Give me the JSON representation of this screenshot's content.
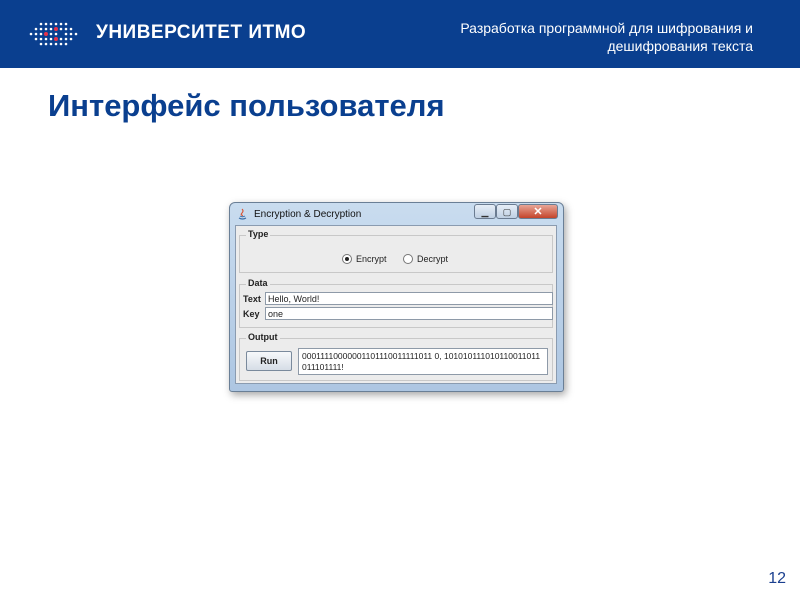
{
  "slide": {
    "brand": "УНИВЕРСИТЕТ ИТМО",
    "header_caption": "Разработка программной для шифрования и дешифрования текста",
    "title": "Интерфейс пользователя",
    "page_number": "12",
    "brand_color": "#0a3f8f"
  },
  "window": {
    "title": "Encryption & Decryption",
    "icon": "java-icon",
    "controls": {
      "minimize": "minimize-icon",
      "maximize": "maximize-icon",
      "close": "close-icon"
    },
    "type_group": {
      "label": "Type",
      "options": [
        {
          "label": "Encrypt",
          "selected": true
        },
        {
          "label": "Decrypt",
          "selected": false
        }
      ]
    },
    "data_group": {
      "label": "Data",
      "text_label": "Text",
      "text_value": "Hello, World!",
      "key_label": "Key",
      "key_value": "one"
    },
    "output_group": {
      "label": "Output",
      "run_label": "Run",
      "output_value": "00011110000001101110011111011 0, 101010111010110011011011101111!"
    }
  }
}
